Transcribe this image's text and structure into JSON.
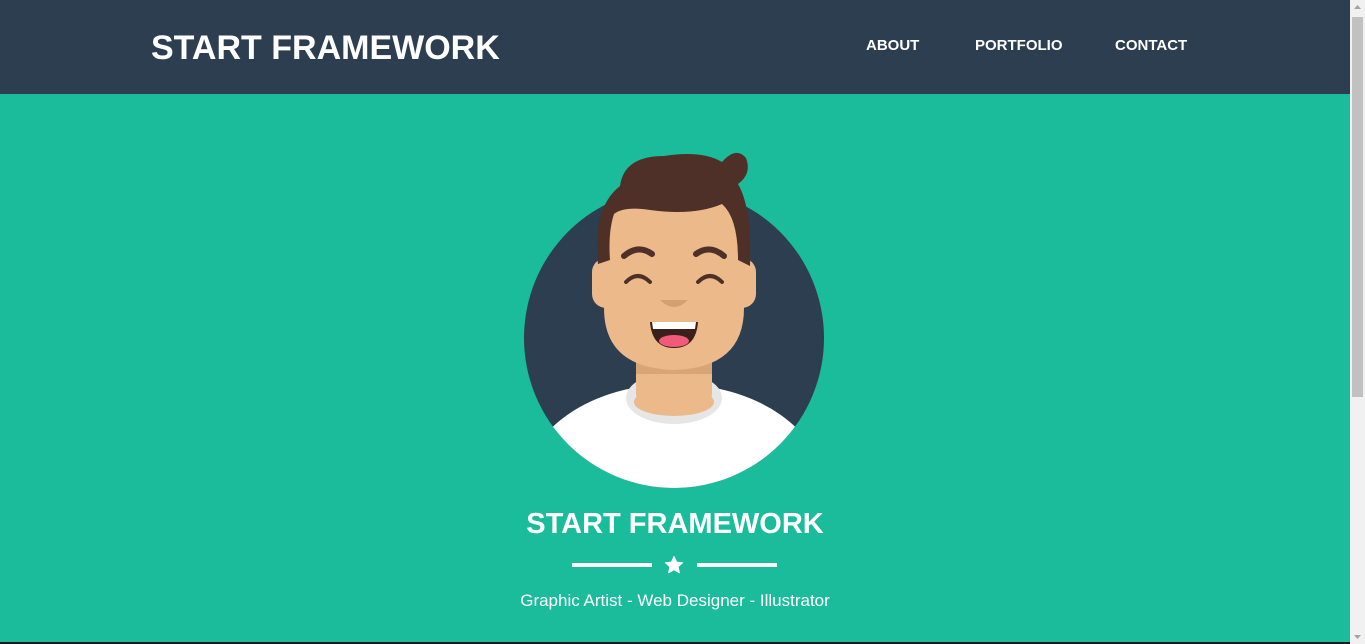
{
  "navbar": {
    "brand": "START FRAMEWORK",
    "links": [
      {
        "label": "ABOUT"
      },
      {
        "label": "PORTFOLIO"
      },
      {
        "label": "CONTACT"
      }
    ]
  },
  "masthead": {
    "avatar_icon": "smiling-man-avatar-icon",
    "heading": "START FRAMEWORK",
    "divider_icon": "star-icon",
    "subheading": "Graphic Artist - Web Designer - Illustrator"
  },
  "colors": {
    "navbar_bg": "#2c3e50",
    "page_bg": "#1abc9c",
    "text": "#ffffff"
  }
}
